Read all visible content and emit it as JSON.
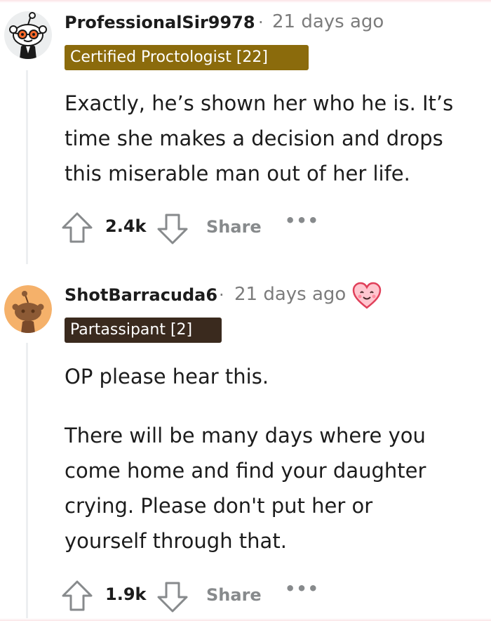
{
  "colors": {
    "flair_gold": "#8b6b0c",
    "flair_dark": "#3a2a1e",
    "meta_gray": "#7c7c7c",
    "action_gray": "#878a8c",
    "thread_line": "#edeff1"
  },
  "comments": [
    {
      "username": "ProfessionalSir9978",
      "separator": "·",
      "time": "21 days ago",
      "flair": "Certified Proctologist [22]",
      "body": [
        "Exactly, he’s shown her who he is. It’s time she makes a decision and drops this miserable man out of her life."
      ],
      "votes": "2.4k",
      "share_label": "Share",
      "more_label": "•••",
      "icons": [
        "upvote-arrow-icon",
        "downvote-arrow-icon",
        "more-options-icon"
      ]
    },
    {
      "username": "ShotBarracuda6",
      "separator": "·",
      "time": "21 days ago",
      "flair": "Partassipant [2]",
      "award_icon": "heart-face-award-icon",
      "body": [
        "OP please hear this.",
        "There will be many days where you come home and find your daughter crying. Please don't put her or yourself through that."
      ],
      "votes": "1.9k",
      "share_label": "Share",
      "more_label": "•••",
      "icons": [
        "upvote-arrow-icon",
        "downvote-arrow-icon",
        "more-options-icon"
      ]
    }
  ]
}
